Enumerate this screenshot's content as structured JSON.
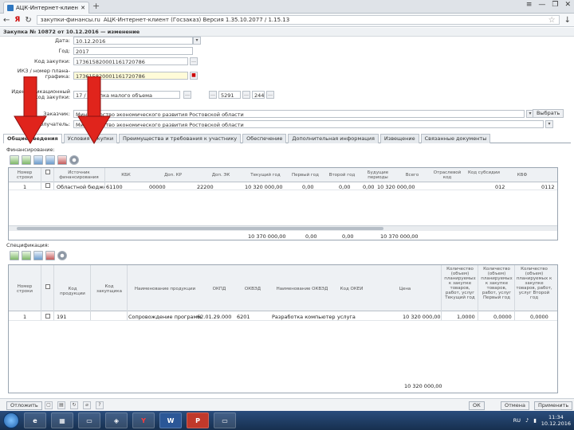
{
  "browser": {
    "tab_title": "АЦК-Интернет-клиент",
    "url_text": "закупки-финансы.ru",
    "page_title": "АЦК-Интернет-клиент (Госзаказ) Версия 1.35.10.2077 / 1.15.13"
  },
  "page_header": "Закупка № 10872 от 10.12.2016 — изменение",
  "form": {
    "date_label": "Дата:",
    "date_value": "10.12.2016",
    "year_label": "Год:",
    "year_value": "2017",
    "code_label": "Код закупки:",
    "code_value": "173615820001161720786",
    "ikz_label": "ИКЗ / номер плана-графика:",
    "ikz_value": "173615820001161720786",
    "okpd_label": "Идентификационный код закупки:",
    "okpd_value": "17 / закупка малого объема",
    "customer_label": "Заказчик:",
    "customer_value": "Министерство экономического развития Ростовской области",
    "recipient_label": "Получатель:",
    "recipient_value": "Министерство экономического развития Ростовской области",
    "select_button": "Выбрать",
    "small_values": [
      "5291",
      "244"
    ]
  },
  "tabs": [
    "Общие сведения",
    "Условия закупки",
    "Преимущества и требования к участнику",
    "Обеспечение",
    "Дополнительная информация",
    "Извещение",
    "Связанные документы"
  ],
  "financing": {
    "title": "Финансирование:",
    "headers": [
      "Номер строки",
      "Источник финансирования",
      "КБК",
      "Доп. КР",
      "Доп. ЭК",
      "Текущий год",
      "Первый год",
      "Второй год",
      "Будущие периоды",
      "Всего",
      "Отраслевой код",
      "Код субсидии",
      "КВФ"
    ],
    "row": [
      "1",
      "Областной бюджет",
      "61100",
      "00000",
      "22200",
      "10 320 000,00",
      "0,00",
      "0,00",
      "0,00",
      "10 320 000,00",
      "",
      "012",
      "0112"
    ],
    "totals": [
      "10 370 000,00",
      "0,00",
      "0,00",
      "10 370 000,00"
    ]
  },
  "specification": {
    "title": "Спецификация:",
    "headers": [
      "Номер строки",
      "",
      "Код продукции",
      "Код закупщика",
      "Наименование продукции",
      "ОКПД",
      "ОКВЭД",
      "Наименование ОКВЭД",
      "Код ОКЕИ",
      "Цена",
      "Количество (объем) планируемых к закупке товаров, работ, услуг Текущий год",
      "Количество (объем) планируемых к закупке товаров, работ, услуг Первый год",
      "Количество (объем) планируемых к закупке товаров, работ, услуг Второй год"
    ],
    "row": [
      "1",
      "",
      "191",
      "",
      "Сопровождение программ",
      "62.01.29.000",
      "6201",
      "Разработка компьютерного ПО",
      "услуга",
      "10 320 000,00",
      "1,0000",
      "0,0000",
      "0,0000"
    ],
    "total": "10 320 000,00"
  },
  "bottom_buttons": [
    "Отложить",
    "ОК",
    "Отмена",
    "Применить"
  ],
  "taskbar": {
    "time": "11:34",
    "date": "10.12.2016",
    "lang": "RU"
  },
  "colors": {
    "arrow": "#e0241c",
    "taskbar": "#1f3c63"
  }
}
